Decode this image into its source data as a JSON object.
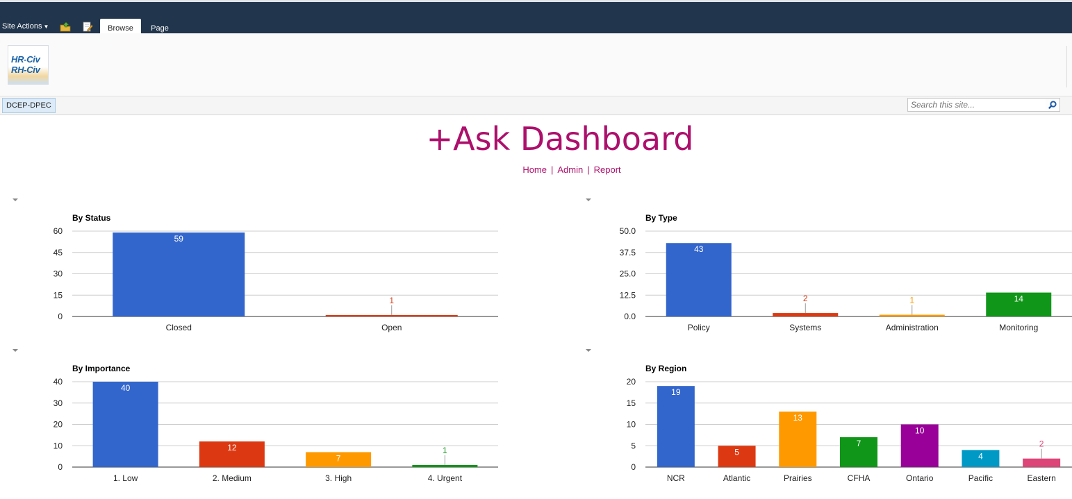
{
  "ribbon": {
    "site_actions": "Site Actions",
    "tabs": [
      {
        "label": "Browse",
        "selected": true
      },
      {
        "label": "Page",
        "selected": false
      }
    ]
  },
  "branding": {
    "logo_line1": "HR-Civ",
    "logo_line2": "RH-Civ"
  },
  "topnav": {
    "item": "DCEP-DPEC"
  },
  "search": {
    "placeholder": "Search this site..."
  },
  "page": {
    "title": "+Ask Dashboard",
    "links": [
      "Home",
      "Admin",
      "Report"
    ]
  },
  "colors": {
    "title": "#ad0f6c",
    "ribbon": "#21354c",
    "palette": [
      "#3366cc",
      "#dc3912",
      "#ff9900",
      "#109618",
      "#990099",
      "#0099c6",
      "#dd4477"
    ]
  },
  "chart_data": [
    {
      "type": "bar",
      "title": "By Status",
      "categories": [
        "Closed",
        "Open"
      ],
      "values": [
        59,
        1
      ],
      "ylim": [
        0,
        60
      ],
      "yticks": [
        "60",
        "45",
        "30",
        "15",
        "0"
      ],
      "grid": true,
      "legend": "none"
    },
    {
      "type": "bar",
      "title": "By Type",
      "categories": [
        "Policy",
        "Systems",
        "Administration",
        "Monitoring"
      ],
      "values": [
        43,
        2,
        1,
        14
      ],
      "ylim": [
        0,
        50
      ],
      "yticks": [
        "50.0",
        "37.5",
        "25.0",
        "12.5",
        "0.0"
      ],
      "grid": true,
      "legend": "none"
    },
    {
      "type": "bar",
      "title": "By Importance",
      "categories": [
        "1. Low",
        "2. Medium",
        "3. High",
        "4. Urgent"
      ],
      "values": [
        40,
        12,
        7,
        1
      ],
      "ylim": [
        0,
        40
      ],
      "yticks": [
        "40",
        "30",
        "20",
        "10",
        "0"
      ],
      "grid": true,
      "legend": "none"
    },
    {
      "type": "bar",
      "title": "By Region",
      "categories": [
        "NCR",
        "Atlantic",
        "Prairies",
        "CFHA",
        "Ontario",
        "Pacific",
        "Eastern"
      ],
      "values": [
        19,
        5,
        13,
        7,
        10,
        4,
        2
      ],
      "ylim": [
        0,
        20
      ],
      "yticks": [
        "20",
        "15",
        "10",
        "5",
        "0"
      ],
      "grid": true,
      "legend": "none"
    }
  ]
}
